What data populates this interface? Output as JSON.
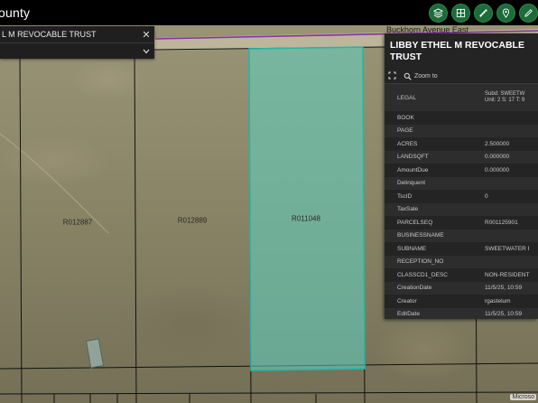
{
  "header": {
    "title": "ounty"
  },
  "toolbar": {
    "buttons": [
      {
        "name": "layers-button",
        "icon": "layers-icon"
      },
      {
        "name": "basemap-button",
        "icon": "grid-icon"
      },
      {
        "name": "measure-button",
        "icon": "measure-icon"
      },
      {
        "name": "locate-button",
        "icon": "location-pin-icon"
      },
      {
        "name": "draw-button",
        "icon": "pencil-icon"
      }
    ]
  },
  "search": {
    "value": "LIBBY ETHEL M REVOCABLE TRUST",
    "visible_value": "L M REVOCABLE TRUST",
    "clear_glyph": "✕",
    "source": ""
  },
  "map": {
    "road_label": "Buckhorn Avenue East",
    "parcels": [
      "R012887",
      "R012889",
      "R011048"
    ],
    "attribution": "Microso"
  },
  "popup": {
    "title": "LIBBY ETHEL M REVOCABLE TRUST",
    "zoom_label": "Zoom to",
    "legal_value_line1": "Subd: SWEETW",
    "legal_value_line2": "Unit: 2 S: 17 T: 9",
    "rows": [
      {
        "key": "LEGAL",
        "value": ""
      },
      {
        "key": "BOOK",
        "value": ""
      },
      {
        "key": "PAGE",
        "value": ""
      },
      {
        "key": "ACRES",
        "value": "2.500000"
      },
      {
        "key": "LANDSQFT",
        "value": "0.000000"
      },
      {
        "key": "AmountDue",
        "value": "0.000000"
      },
      {
        "key": "Delinquent",
        "value": ""
      },
      {
        "key": "TscID",
        "value": "0"
      },
      {
        "key": "TaxSale",
        "value": ""
      },
      {
        "key": "PARCELSEQ",
        "value": "R001125901"
      },
      {
        "key": "BUSINESSNAME",
        "value": ""
      },
      {
        "key": "SUBNAME",
        "value": "SWEETWATER I"
      },
      {
        "key": "RECEPTION_NO",
        "value": ""
      },
      {
        "key": "CLASSCD1_DESC",
        "value": "NON-RESIDENT"
      },
      {
        "key": "CreationDate",
        "value": "11/5/25, 10:59"
      },
      {
        "key": "Creator",
        "value": "rgastelum"
      },
      {
        "key": "EditDate",
        "value": "11/5/25, 10:59"
      }
    ]
  },
  "colors": {
    "topbar": "#000000",
    "tool_button": "#1d6b39",
    "selected_parcel_fill": "#5fd3c2",
    "road_line": "#8a2fa8",
    "popup_bg": "#242424"
  }
}
